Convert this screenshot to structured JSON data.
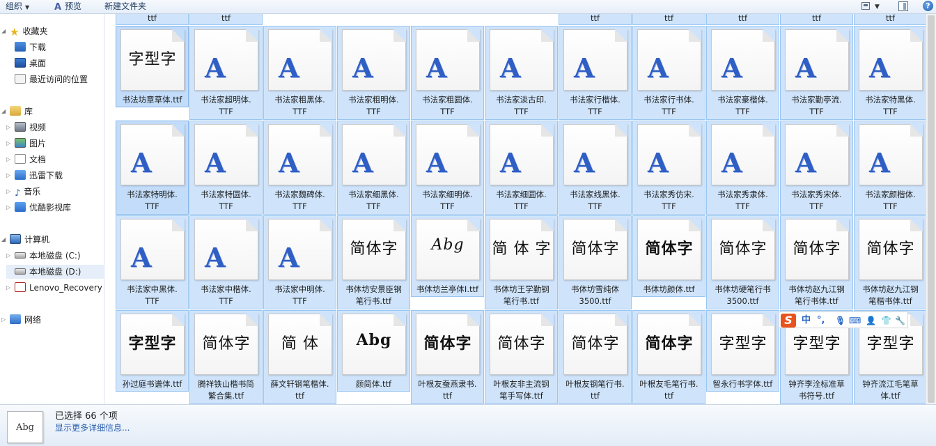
{
  "toolbar": {
    "organize_label": "组织",
    "preview_label": "预览",
    "newfolder_label": "新建文件夹"
  },
  "nav": {
    "favorites": "收藏夹",
    "downloads": "下载",
    "desktop": "桌面",
    "recent": "最近访问的位置",
    "libraries": "库",
    "videos": "视频",
    "pictures": "图片",
    "documents": "文档",
    "xunlei": "迅雷下载",
    "music": "音乐",
    "youku": "优酷影视库",
    "computer": "计算机",
    "disk_c": "本地磁盘 (C:)",
    "disk_d": "本地磁盘 (D:)",
    "lenovo": "Lenovo_Recovery (",
    "network": "网络"
  },
  "top_row": [
    "ttf",
    "ttf",
    "ttf",
    "ttf",
    "ttf",
    "ttf",
    "ttf",
    "ttf",
    "ttf",
    "ttf",
    "ttf"
  ],
  "files": [
    {
      "line1": "书法坊章草体.ttf",
      "line2": "",
      "preview": "字型字",
      "style": "script"
    },
    {
      "line1": "书法家超明体.",
      "line2": "TTF",
      "preview": "A",
      "style": "a"
    },
    {
      "line1": "书法家粗黑体.",
      "line2": "TTF",
      "preview": "A",
      "style": "a"
    },
    {
      "line1": "书法家粗明体.",
      "line2": "TTF",
      "preview": "A",
      "style": "a"
    },
    {
      "line1": "书法家粗圆体.",
      "line2": "TTF",
      "preview": "A",
      "style": "a"
    },
    {
      "line1": "书法家淡古印.",
      "line2": "TTF",
      "preview": "A",
      "style": "a"
    },
    {
      "line1": "书法家行楷体.",
      "line2": "TTF",
      "preview": "A",
      "style": "a"
    },
    {
      "line1": "书法家行书体.",
      "line2": "TTF",
      "preview": "A",
      "style": "a"
    },
    {
      "line1": "书法家豪楷体.",
      "line2": "TTF",
      "preview": "A",
      "style": "a"
    },
    {
      "line1": "书法家勤亭流.",
      "line2": "TTF",
      "preview": "A",
      "style": "a"
    },
    {
      "line1": "书法家特黑体.",
      "line2": "TTF",
      "preview": "A",
      "style": "a"
    },
    {
      "line1": "书法家特明体.",
      "line2": "TTF",
      "preview": "A",
      "style": "a"
    },
    {
      "line1": "书法家特圆体.",
      "line2": "TTF",
      "preview": "A",
      "style": "a"
    },
    {
      "line1": "书法家魏碑体.",
      "line2": "TTF",
      "preview": "A",
      "style": "a"
    },
    {
      "line1": "书法家细黑体.",
      "line2": "TTF",
      "preview": "A",
      "style": "a"
    },
    {
      "line1": "书法家细明体.",
      "line2": "TTF",
      "preview": "A",
      "style": "a"
    },
    {
      "line1": "书法家细圆体.",
      "line2": "TTF",
      "preview": "A",
      "style": "a"
    },
    {
      "line1": "书法家线黑体.",
      "line2": "TTF",
      "preview": "A",
      "style": "a"
    },
    {
      "line1": "书法家秀仿宋.",
      "line2": "TTF",
      "preview": "A",
      "style": "a"
    },
    {
      "line1": "书法家秀隶体.",
      "line2": "TTF",
      "preview": "A",
      "style": "a"
    },
    {
      "line1": "书法家秀宋体.",
      "line2": "TTF",
      "preview": "A",
      "style": "a"
    },
    {
      "line1": "书法家颜楷体.",
      "line2": "TTF",
      "preview": "A",
      "style": "a"
    },
    {
      "line1": "书法家中黑体.",
      "line2": "TTF",
      "preview": "A",
      "style": "a"
    },
    {
      "line1": "书法家中楷体.",
      "line2": "TTF",
      "preview": "A",
      "style": "a"
    },
    {
      "line1": "书法家中明体.",
      "line2": "TTF",
      "preview": "A",
      "style": "a"
    },
    {
      "line1": "书体坊安景臣钢",
      "line2": "笔行书.ttf",
      "preview": "简体字",
      "style": "script"
    },
    {
      "line1": "书体坊兰亭体I.ttf",
      "line2": "",
      "preview": "Abg",
      "style": "ital"
    },
    {
      "line1": "书体坊王学勤钢",
      "line2": "笔行书.ttf",
      "preview": "简 体 字",
      "style": "script"
    },
    {
      "line1": "书体坊雪纯体",
      "line2": "3500.ttf",
      "preview": "简体字",
      "style": "script"
    },
    {
      "line1": "书体坊颜体.ttf",
      "line2": "",
      "preview": "简体字",
      "style": "bold"
    },
    {
      "line1": "书体坊硬笔行书",
      "line2": "3500.ttf",
      "preview": "简体字",
      "style": "script"
    },
    {
      "line1": "书体坊赵九江钢",
      "line2": "笔行书体.ttf",
      "preview": "简体字",
      "style": "script"
    },
    {
      "line1": "书体坊赵九江钢",
      "line2": "笔楷书体.ttf",
      "preview": "简体字",
      "style": "script"
    },
    {
      "line1": "孙过庭书谱体.ttf",
      "line2": "",
      "preview": "字型字",
      "style": "bold"
    },
    {
      "line1": "腾祥铁山楷书简",
      "line2": "繁合集.ttf",
      "preview": "简体字",
      "style": "script"
    },
    {
      "line1": "薛文轩钢笔楷体.",
      "line2": "ttf",
      "preview": "简 体",
      "style": "script"
    },
    {
      "line1": "颜简体.ttf",
      "line2": "",
      "preview": "Abg",
      "style": "bold"
    },
    {
      "line1": "叶根友蚕燕隶书.",
      "line2": "ttf",
      "preview": "简体字",
      "style": "bold"
    },
    {
      "line1": "叶根友非主流钢",
      "line2": "笔手写体.ttf",
      "preview": "简体字",
      "style": "script"
    },
    {
      "line1": "叶根友钢笔行书.",
      "line2": "ttf",
      "preview": "简体字",
      "style": "script"
    },
    {
      "line1": "叶根友毛笔行书.",
      "line2": "ttf",
      "preview": "简体字",
      "style": "bold"
    },
    {
      "line1": "智永行书字体.ttf",
      "line2": "",
      "preview": "字型字",
      "style": "script"
    },
    {
      "line1": "钟齐李洤标准草",
      "line2": "书符号.ttf",
      "preview": "字型字",
      "style": "script"
    },
    {
      "line1": "钟齐流江毛笔草",
      "line2": "体.ttf",
      "preview": "字型字",
      "style": "script"
    }
  ],
  "status": {
    "selected_text": "已选择 66 个项",
    "details_link": "显示更多详细信息...",
    "thumb_label": "Abg"
  },
  "ime": {
    "logo": "S",
    "lang": "中",
    "punct": "°,"
  }
}
